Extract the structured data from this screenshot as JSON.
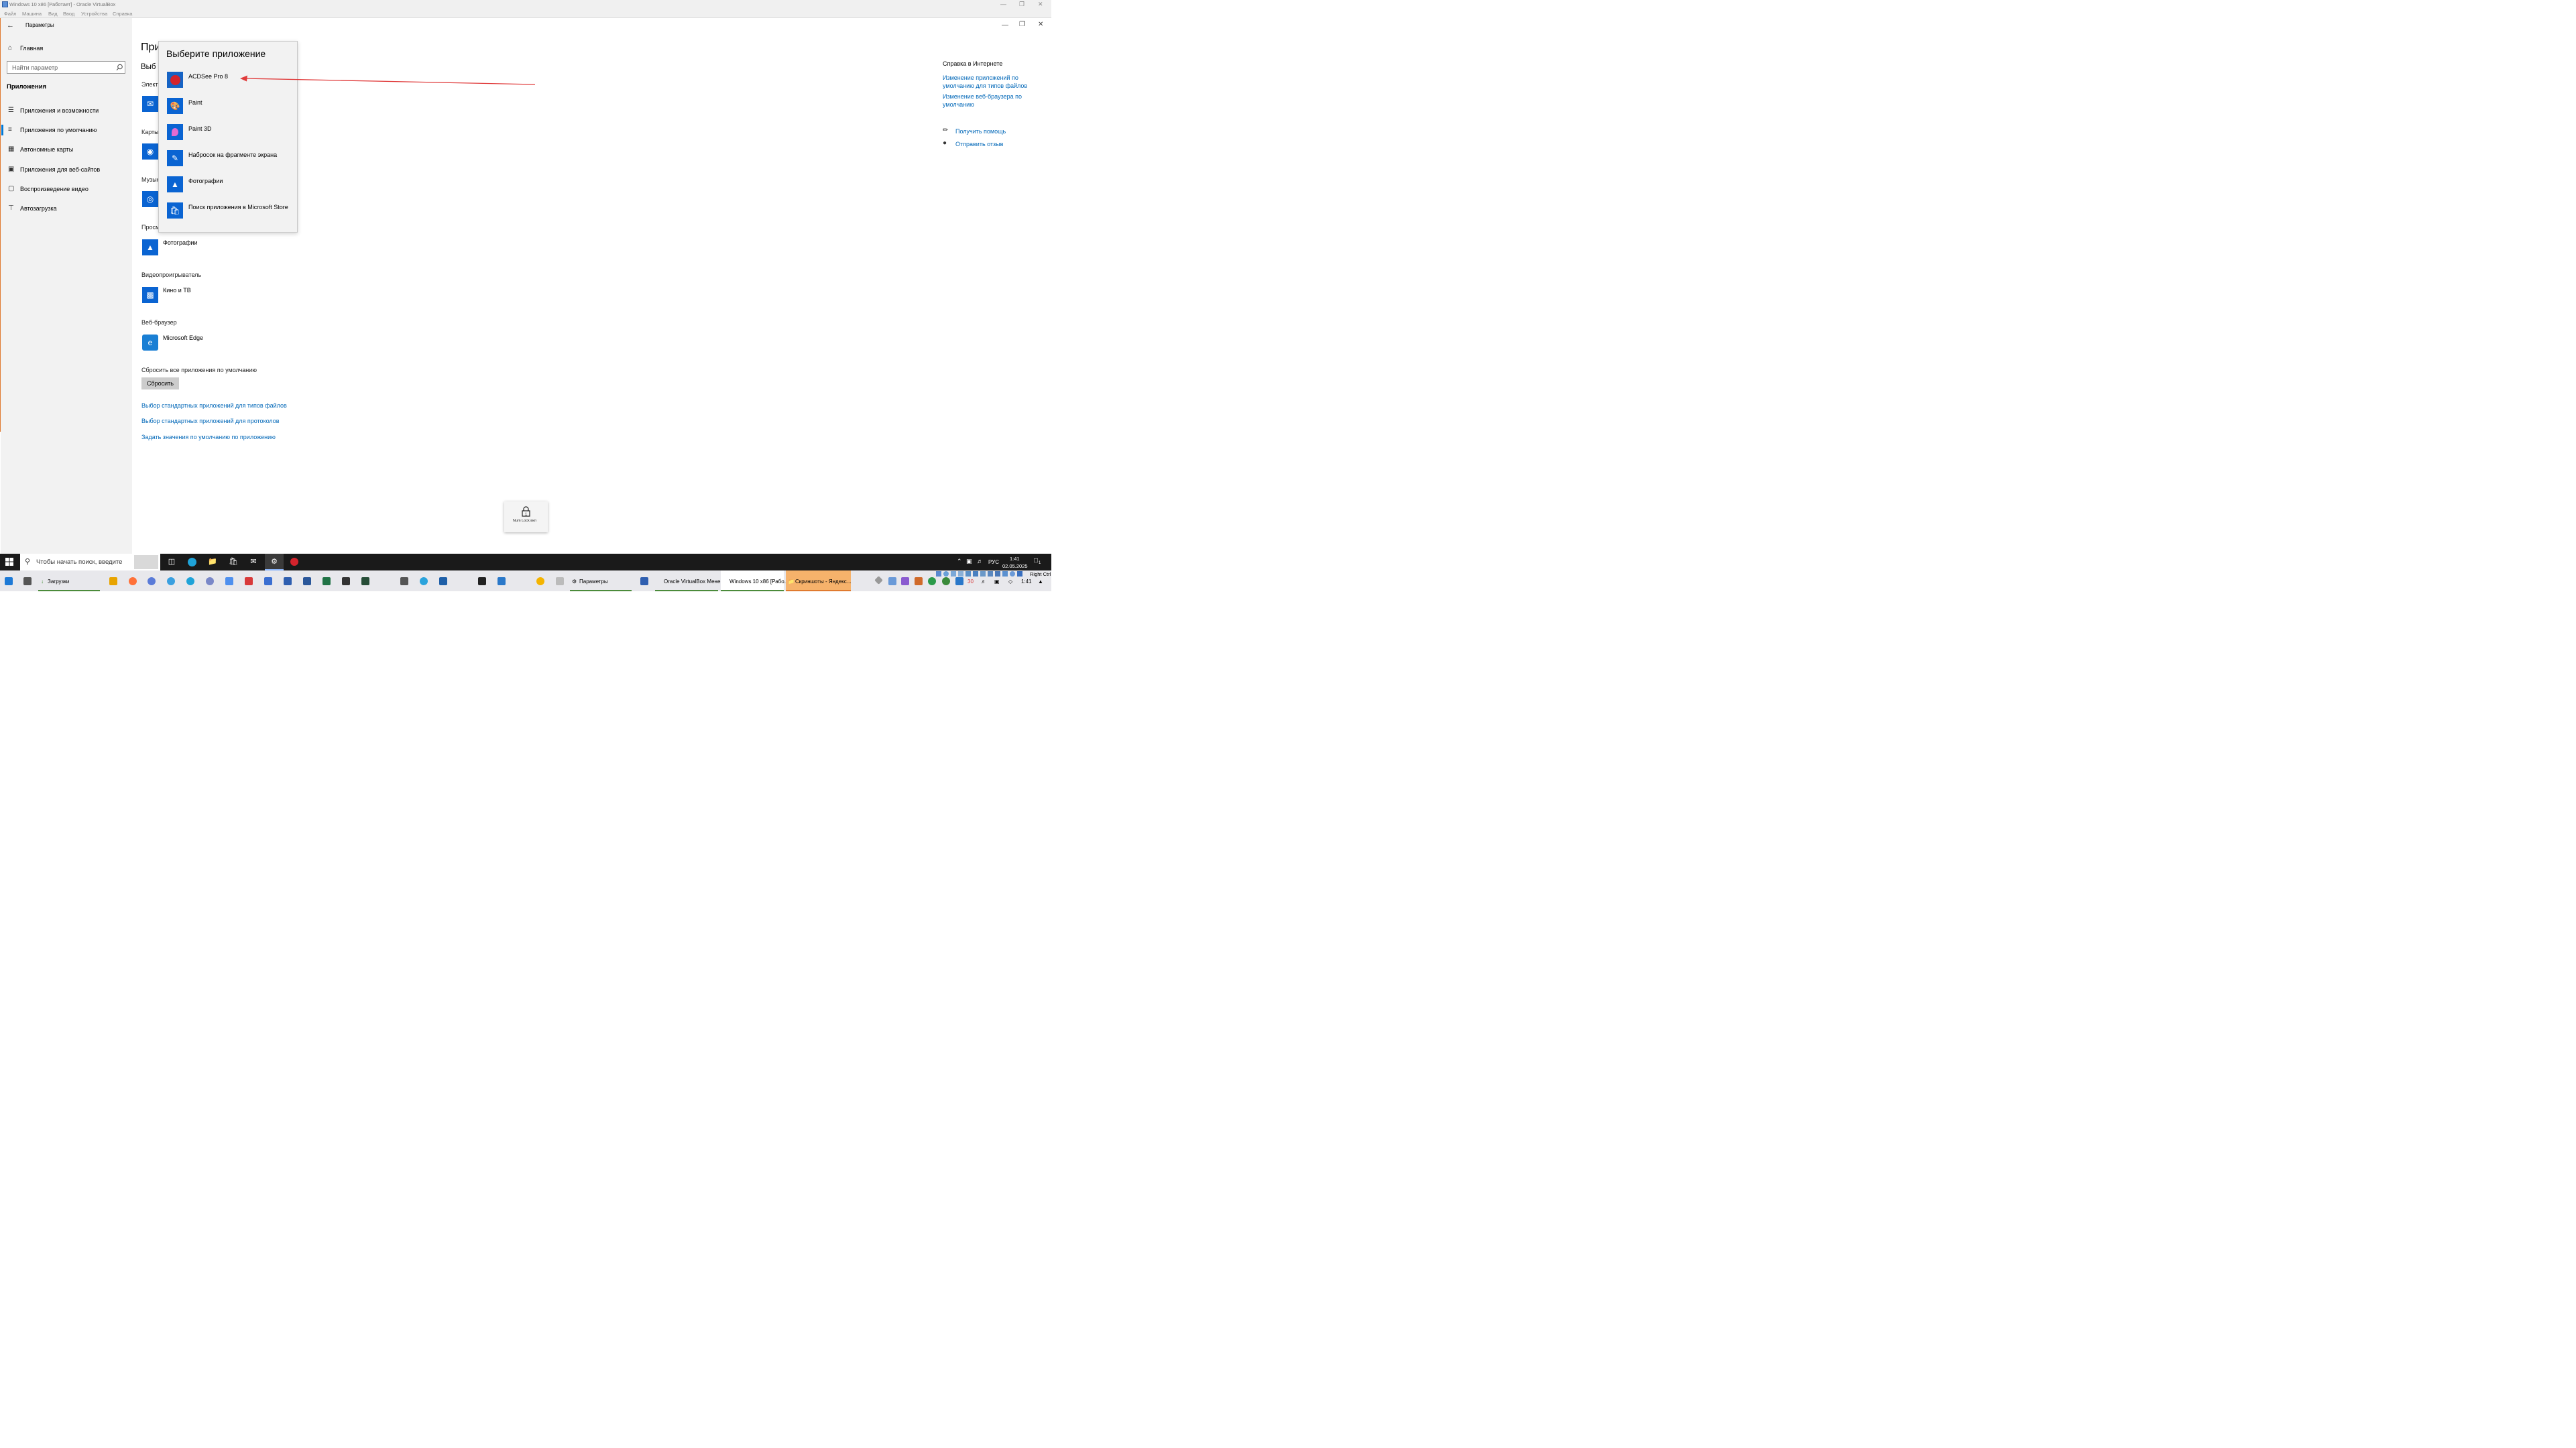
{
  "vbox": {
    "title": "Windows 10 x86 [Работает] - Oracle VirtualBox",
    "menu": [
      "Файл",
      "Машина",
      "Вид",
      "Ввод",
      "Устройства",
      "Справка"
    ]
  },
  "settings": {
    "window_title": "Параметры",
    "home": "Главная",
    "search_placeholder": "Найти параметр",
    "section": "Приложения",
    "nav": [
      {
        "label": "Приложения и возможности",
        "icon": "apps-list-icon"
      },
      {
        "label": "Приложения по умолчанию",
        "icon": "default-apps-icon",
        "selected": true
      },
      {
        "label": "Автономные карты",
        "icon": "offline-maps-icon"
      },
      {
        "label": "Приложения для веб-сайтов",
        "icon": "apps-for-websites-icon"
      },
      {
        "label": "Воспроизведение видео",
        "icon": "video-playback-icon"
      },
      {
        "label": "Автозагрузка",
        "icon": "startup-icon"
      }
    ]
  },
  "main": {
    "page_title_partial": "При",
    "subtitle_partial": "Выб",
    "categories": [
      {
        "label_partial": "Электр"
      },
      {
        "label_partial": "Карты"
      },
      {
        "label_partial": "Музык"
      },
      {
        "label_partial": "Просм",
        "app": "Фотографии"
      },
      {
        "label": "Видеопроигрыватель",
        "app": "Кино и ТВ"
      },
      {
        "label": "Веб-браузер",
        "app": "Microsoft Edge"
      }
    ],
    "reset_label": "Сбросить все приложения по умолчанию",
    "reset_button": "Сбросить",
    "links": [
      "Выбор стандартных приложений для типов файлов",
      "Выбор стандартных приложений для протоколов",
      "Задать значения по умолчанию по приложению"
    ]
  },
  "help": {
    "title": "Справка в Интернете",
    "links": [
      "Изменение приложений по умолчанию для типов файлов",
      "Изменение веб-браузера по умолчанию"
    ],
    "get_help": "Получить помощь",
    "feedback": "Отправить отзыв"
  },
  "chooser": {
    "title": "Выберите приложение",
    "items": [
      {
        "label": "ACDSee Pro 8",
        "icon": "acdsee-icon"
      },
      {
        "label": "Paint",
        "icon": "paint-icon"
      },
      {
        "label": "Paint 3D",
        "icon": "paint3d-icon"
      },
      {
        "label": "Набросок на фрагменте экрана",
        "icon": "snip-sketch-icon"
      },
      {
        "label": "Фотографии",
        "icon": "photos-icon"
      },
      {
        "label": "Поиск приложения в Microsoft Store",
        "icon": "store-icon"
      }
    ]
  },
  "toast": {
    "numlock": "Num Lock вкл"
  },
  "guest_taskbar": {
    "search_placeholder": "Чтобы начать поиск, введите",
    "lang": "РУС",
    "time": "1:41",
    "date": "02.05.2025",
    "notifications": "1"
  },
  "host_taskbar": {
    "downloads": "Загрузки",
    "tasks": [
      "Параметры",
      "Oracle VirtualBox Мене...",
      "Windows 10 x86 [Рабо...",
      "Скриншоты - Яндекс..."
    ],
    "tray_number": "30",
    "time": "1:41",
    "right_ctrl": "Right Ctrl"
  },
  "colors": {
    "accent": "#0078d7",
    "link": "#0067b8",
    "tile": "#0a64d2",
    "arrow": "#e03b3b"
  }
}
